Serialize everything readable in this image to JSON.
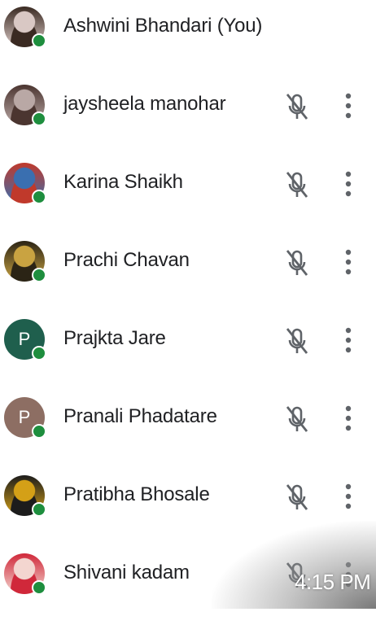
{
  "participants": [
    {
      "name": "Ashwini Bhandari (You)",
      "avatar": "photo",
      "colors": [
        "#d9c8c4",
        "#3a2a22"
      ],
      "online_color": "#1e8e3e",
      "show_controls": false
    },
    {
      "name": "jaysheela manohar",
      "avatar": "photo",
      "colors": [
        "#b9a8a5",
        "#4b3530"
      ],
      "online_color": "#1e8e3e",
      "show_controls": true
    },
    {
      "name": "Karina Shaikh",
      "avatar": "photo",
      "colors": [
        "#3a6fb0",
        "#c0392b"
      ],
      "online_color": "#1e8e3e",
      "show_controls": true
    },
    {
      "name": "Prachi Chavan",
      "avatar": "photo",
      "colors": [
        "#c9a341",
        "#2b2415"
      ],
      "online_color": "#1e8e3e",
      "show_controls": true
    },
    {
      "name": "Prajkta Jare",
      "avatar": "letter",
      "letter": "P",
      "colors": [
        "#1f5f4d"
      ],
      "online_color": "#1e8e3e",
      "show_controls": true
    },
    {
      "name": "Pranali Phadatare",
      "avatar": "letter",
      "letter": "P",
      "colors": [
        "#8d6e63"
      ],
      "online_color": "#1e8e3e",
      "show_controls": true
    },
    {
      "name": "Pratibha Bhosale",
      "avatar": "photo",
      "colors": [
        "#d4a017",
        "#1c1c1c"
      ],
      "online_color": "#1e8e3e",
      "show_controls": true
    },
    {
      "name": "Shivani kadam",
      "avatar": "photo",
      "colors": [
        "#f3d6d0",
        "#d0283a"
      ],
      "online_color": "#1e8e3e",
      "show_controls": true
    }
  ],
  "icons": {
    "mic": "mic-off-icon",
    "more": "more-vert-icon"
  },
  "overlay": {
    "time": "4:15 PM"
  }
}
